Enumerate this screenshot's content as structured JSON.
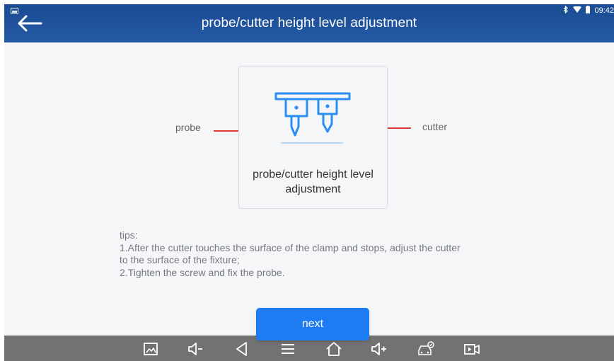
{
  "status_bar": {
    "time": "09:42",
    "icons": [
      "image-icon",
      "bluetooth-icon",
      "wifi-icon",
      "battery-icon"
    ]
  },
  "header": {
    "title": "probe/cutter height level adjustment",
    "back_icon": "back-arrow-icon"
  },
  "illustration": {
    "caption_line1": "probe/cutter height level",
    "caption_line2": "adjustment",
    "probe_label": "probe",
    "cutter_label": "cutter",
    "accent_color": "#2b8ef0",
    "pointer_color": "#e03a3a"
  },
  "tips": {
    "heading": "tips:",
    "line1": "1.After the cutter touches the surface of the clamp and stops, adjust the cutter",
    "line2": "to the surface of the fixture;",
    "line3": "2.Tighten the screw and fix the probe."
  },
  "next_button": {
    "label": "next",
    "color": "#1e7cf2"
  },
  "nav_bar": {
    "icons": [
      "screenshot-icon",
      "volume-down-icon",
      "back-triangle-icon",
      "menu-icon",
      "home-icon",
      "volume-up-icon",
      "car-diagnostic-icon",
      "screen-record-icon"
    ]
  }
}
